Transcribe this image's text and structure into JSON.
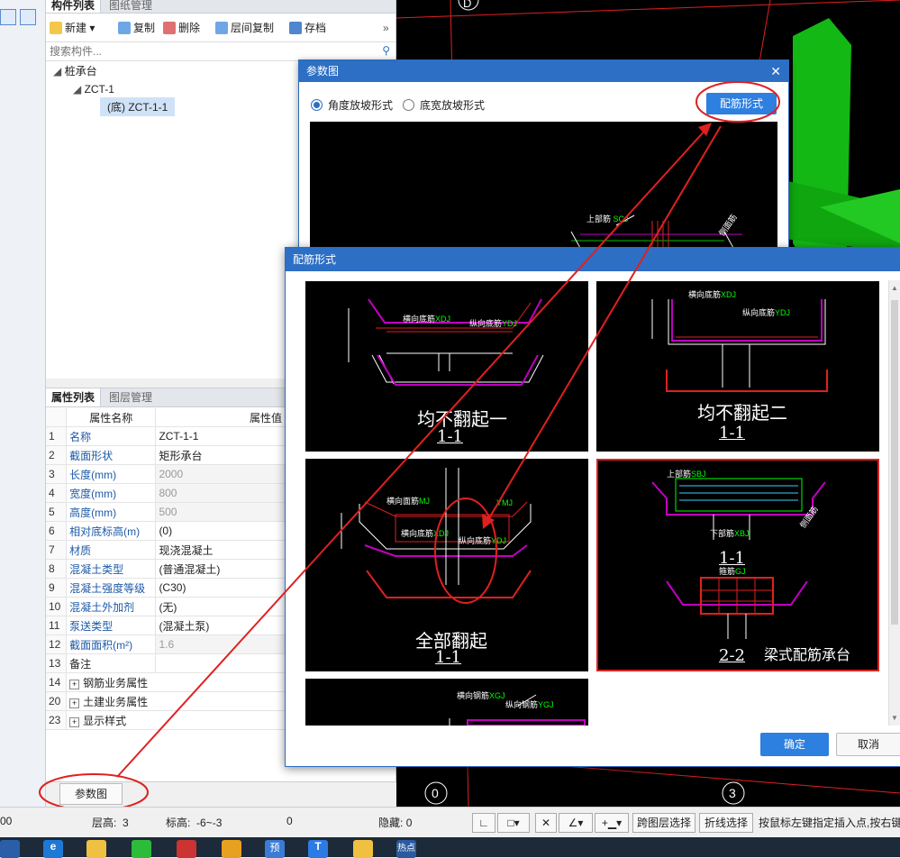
{
  "component_panel": {
    "tabs": [
      "构件列表",
      "图纸管理"
    ],
    "toolbar": {
      "new": "新建",
      "copy": "复制",
      "delete": "删除",
      "floor_copy": "层间复制",
      "save": "存档"
    },
    "search_placeholder": "搜索构件...",
    "tree": {
      "root": "桩承台",
      "child": "ZCT-1",
      "leaf": "(底) ZCT-1-1"
    }
  },
  "property_panel": {
    "tabs": [
      "属性列表",
      "图层管理"
    ],
    "headers": {
      "name": "属性名称",
      "value": "属性值"
    },
    "rows": [
      {
        "num": "1",
        "name": "名称",
        "value": "ZCT-1-1",
        "editable": true
      },
      {
        "num": "2",
        "name": "截面形状",
        "value": "矩形承台",
        "editable": true
      },
      {
        "num": "3",
        "name": "长度(mm)",
        "value": "2000",
        "editable": false
      },
      {
        "num": "4",
        "name": "宽度(mm)",
        "value": "800",
        "editable": false
      },
      {
        "num": "5",
        "name": "高度(mm)",
        "value": "500",
        "editable": false
      },
      {
        "num": "6",
        "name": "相对底标高(m)",
        "value": "(0)",
        "editable": true
      },
      {
        "num": "7",
        "name": "材质",
        "value": "现浇混凝土",
        "editable": true
      },
      {
        "num": "8",
        "name": "混凝土类型",
        "value": "(普通混凝土)",
        "editable": true
      },
      {
        "num": "9",
        "name": "混凝土强度等级",
        "value": "(C30)",
        "editable": true
      },
      {
        "num": "10",
        "name": "混凝土外加剂",
        "value": "(无)",
        "editable": true
      },
      {
        "num": "11",
        "name": "泵送类型",
        "value": "(混凝土泵)",
        "editable": true
      },
      {
        "num": "12",
        "name": "截面面积(m²)",
        "value": "1.6",
        "editable": false
      },
      {
        "num": "13",
        "name": "备注",
        "value": "",
        "editable": true
      },
      {
        "num": "14",
        "name": "钢筋业务属性",
        "value": "",
        "group": true
      },
      {
        "num": "20",
        "name": "土建业务属性",
        "value": "",
        "group": true
      },
      {
        "num": "23",
        "name": "显示样式",
        "value": "",
        "group": true
      }
    ],
    "param_button": "参数图"
  },
  "dialog_param": {
    "title": "参数图",
    "radio_angle": "角度放坡形式",
    "radio_width": "底宽放坡形式",
    "rebar_button": "配筋形式",
    "preview_labels": {
      "top": "上部筋",
      "top_code": "SCJ",
      "side": "侧面筋"
    }
  },
  "dialog_rebar": {
    "title": "配筋形式",
    "options": [
      {
        "caption": "均不翻起一",
        "section": "1-1"
      },
      {
        "caption": "均不翻起二",
        "section": "1-1"
      },
      {
        "caption": "全部翻起",
        "section": "1-1"
      },
      {
        "caption": "梁式配筋承台",
        "section": "1-1",
        "section2": "2-2",
        "selected": true
      }
    ],
    "drawing_labels": {
      "horiz_face": "横向面筋",
      "horiz_bottom": "横向底筋",
      "vert_bottom": "纵向底筋",
      "vert_face": "纵向面筋",
      "side": "侧面筋",
      "top": "上部筋",
      "bottom": "下部筋",
      "horiz_steel": "横向钢筋",
      "vert_steel": "纵向钢筋",
      "stirrup": "箍筋",
      "codes": [
        "MJ",
        "XDJ",
        "YDJ",
        "YMJ",
        "CMJ",
        "SBJ",
        "XBJ",
        "GJ",
        "XGJ",
        "YGJ",
        "CMJ1",
        "CMJ2",
        "XMJ"
      ]
    },
    "ok": "确定",
    "cancel": "取消"
  },
  "canvas": {
    "axis_labels": [
      "D",
      "0",
      "3"
    ]
  },
  "status_bar": {
    "coord_value": "00",
    "floor_height_label": "层高:",
    "floor_height": "3",
    "elevation_label": "标高:",
    "elevation": "-6~-3",
    "zero": "0",
    "hidden_label": "隐藏:",
    "hidden": "0",
    "cross_layer": "跨图层选择",
    "polyline_select": "折线选择",
    "hint": "按鼠标左键指定插入点,按右键"
  },
  "taskbar": {
    "icons": [
      "edge-icon",
      "explorer-icon",
      "wechat-icon",
      "app-icon",
      "app2-icon",
      "yu-icon",
      "t-icon",
      "help-icon",
      "hotspot-icon"
    ],
    "labels": {
      "yu": "预",
      "t": "T",
      "hot": "热点"
    }
  },
  "colors": {
    "accent": "#2d6fc4",
    "highlight": "#e02020",
    "canvas": "#000000",
    "green": "#00c000"
  }
}
